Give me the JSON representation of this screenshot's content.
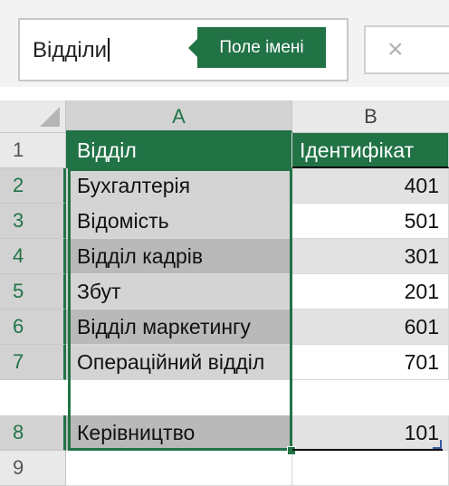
{
  "name_box": {
    "value": "Відділи",
    "callout": "Поле імені",
    "cancel_label": "×"
  },
  "columns": [
    "A",
    "B"
  ],
  "rows": [
    {
      "num": "1",
      "a": "Відділ",
      "b": "Ідентифікат"
    },
    {
      "num": "2",
      "a": "Бухгалтерія",
      "b": "401"
    },
    {
      "num": "3",
      "a": "Відомість",
      "b": "501"
    },
    {
      "num": "4",
      "a": "Відділ кадрів",
      "b": "301"
    },
    {
      "num": "5",
      "a": "Збут",
      "b": "201"
    },
    {
      "num": "6",
      "a": "Відділ маркетингу",
      "b": "601"
    },
    {
      "num": "7",
      "a": "Операційний відділ",
      "b": "701"
    },
    {
      "num": "8",
      "a": "Керівництво",
      "b": "101"
    },
    {
      "num": "9",
      "a": "",
      "b": ""
    }
  ],
  "colors": {
    "accent": "#217346"
  }
}
